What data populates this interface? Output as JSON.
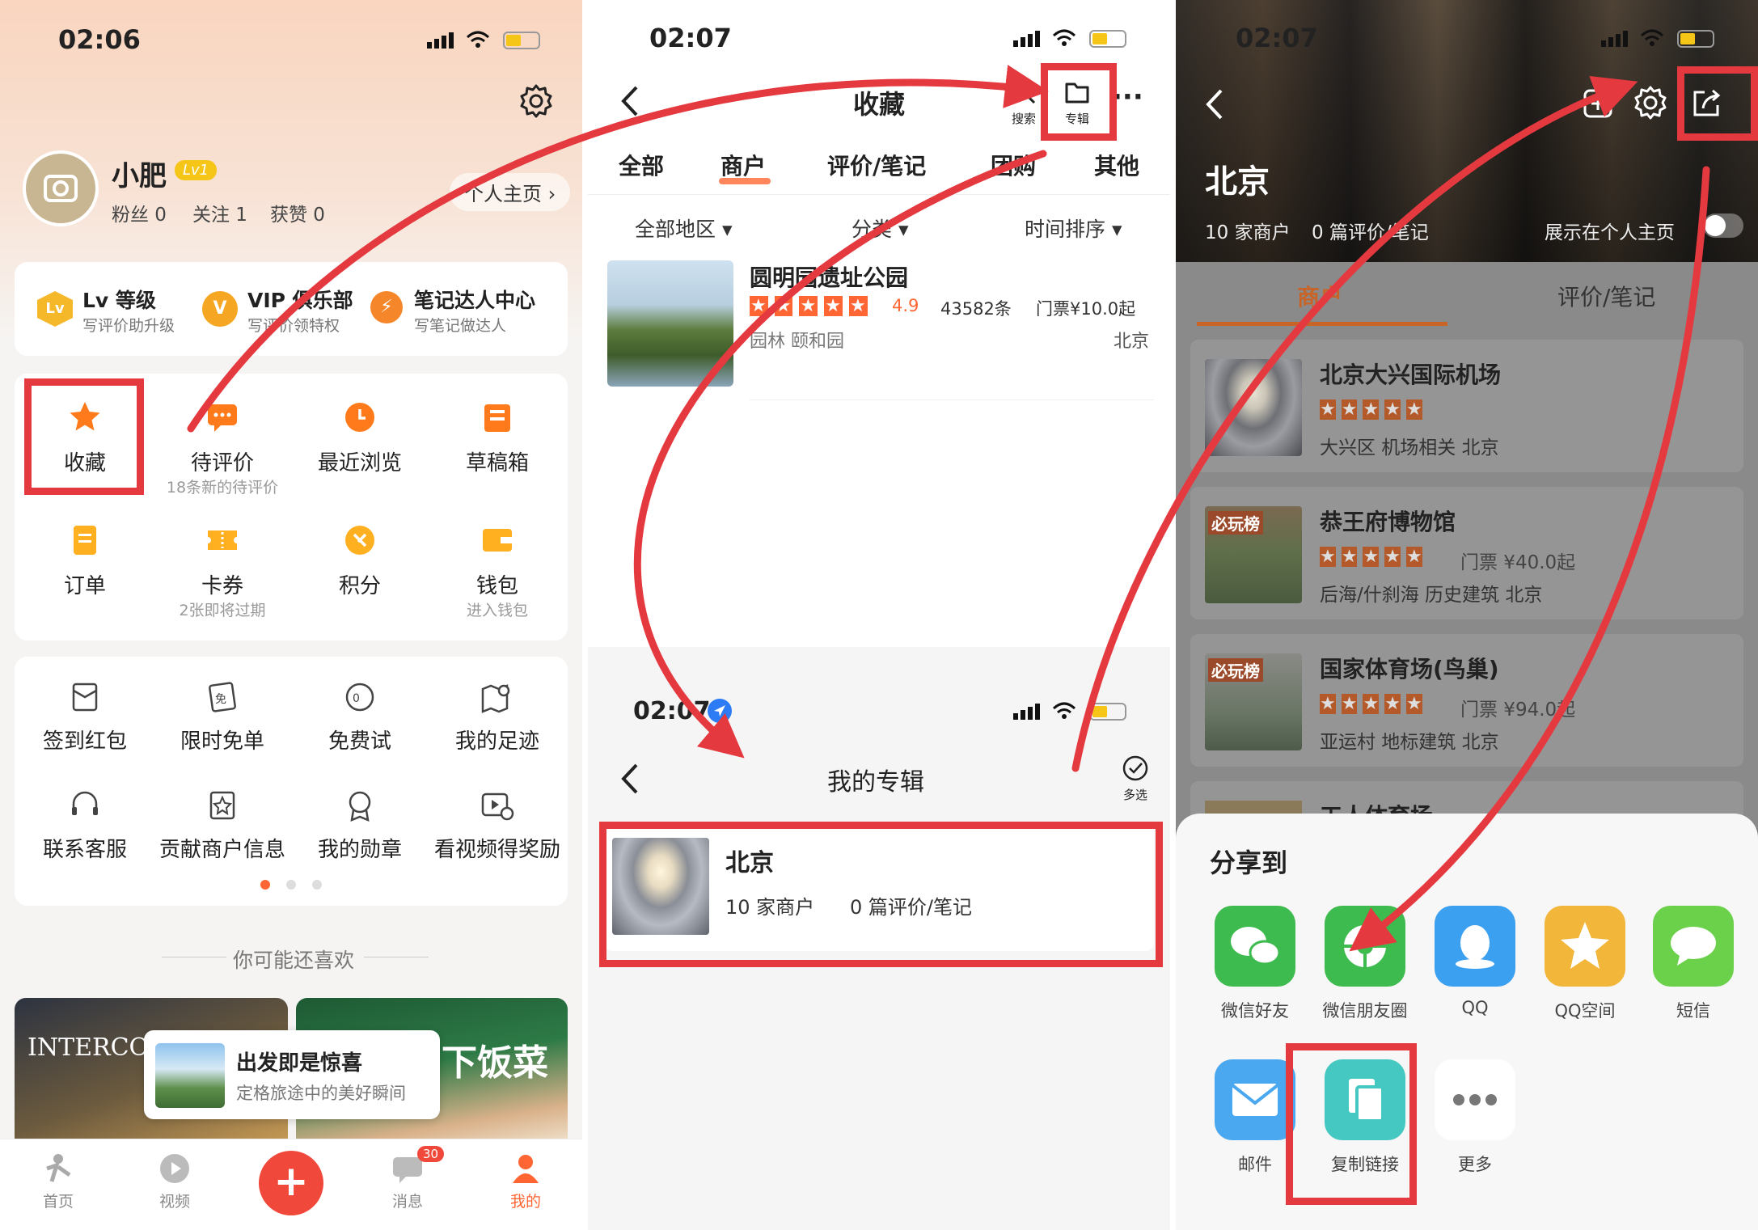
{
  "p1": {
    "time": "02:06",
    "username": "小肥",
    "level_badge": "Lv1",
    "stats": [
      "粉丝 0",
      "关注 1",
      "获赞 0"
    ],
    "homepage_btn": "个人主页 ›",
    "perks": [
      {
        "title": "Lv 等级",
        "sub": "写评价助升级",
        "icon": "Lv"
      },
      {
        "title": "VIP 俱乐部",
        "sub": "写评价领特权",
        "icon": "V"
      },
      {
        "title": "笔记达人中心",
        "sub": "写笔记做达人",
        "icon": "⚡"
      }
    ],
    "grid1": [
      {
        "label": "收藏",
        "sub": ""
      },
      {
        "label": "待评价",
        "sub": "18条新的待评价"
      },
      {
        "label": "最近浏览",
        "sub": ""
      },
      {
        "label": "草稿箱",
        "sub": ""
      },
      {
        "label": "订单",
        "sub": ""
      },
      {
        "label": "卡券",
        "sub": "2张即将过期"
      },
      {
        "label": "积分",
        "sub": ""
      },
      {
        "label": "钱包",
        "sub": "进入钱包"
      }
    ],
    "grid2": [
      {
        "label": "签到红包"
      },
      {
        "label": "限时免单"
      },
      {
        "label": "免费试"
      },
      {
        "label": "我的足迹"
      },
      {
        "label": "联系客服"
      },
      {
        "label": "贡献商户信息"
      },
      {
        "label": "我的勋章"
      },
      {
        "label": "看视频得奖励"
      }
    ],
    "recommend_title": "你可能还喜欢",
    "banner_title": "出发即是惊喜",
    "banner_sub": "定格旅途中的美好瞬间",
    "banner_text_right": "下饭菜",
    "hotel_text": "INTERCO",
    "tabbar": [
      {
        "label": "首页"
      },
      {
        "label": "视频"
      },
      {
        "label": "+"
      },
      {
        "label": "消息",
        "badge": "30"
      },
      {
        "label": "我的"
      }
    ]
  },
  "p2": {
    "time": "02:07",
    "title": "收藏",
    "search_label": "搜索",
    "album_label": "专辑",
    "more": "···",
    "tabs": [
      "全部",
      "商户",
      "评价/笔记",
      "团购",
      "其他"
    ],
    "filters": [
      "全部地区 ▾",
      "分类 ▾",
      "时间排序 ▾"
    ],
    "item": {
      "name": "圆明园遗址公园",
      "rating": "4.9",
      "reviews": "43582条",
      "price": "门票¥10.0起",
      "tags": "园林 颐和园",
      "city": "北京"
    },
    "time2": "02:07",
    "title2": "我的专辑",
    "multi_select": "多选",
    "album": {
      "name": "北京",
      "count": "10 家商户",
      "notes": "0 篇评价/笔记"
    }
  },
  "p3": {
    "time": "02:07",
    "city": "北京",
    "count": "10 家商户",
    "notes": "0 篇评价/笔记",
    "show_homepage": "展示在个人主页",
    "tabs": [
      "商户",
      "评价/笔记"
    ],
    "items": [
      {
        "name": "北京大兴国际机场",
        "line2": "",
        "tags": "大兴区 机场相关  北京"
      },
      {
        "name": "恭王府博物馆",
        "line2": "门票 ¥40.0起",
        "tags": "后海/什刹海 历史建筑  北京",
        "badge": "必玩榜"
      },
      {
        "name": "国家体育场(鸟巢)",
        "line2": "门票 ¥94.0起",
        "tags": "亚运村 地标建筑  北京",
        "badge": "必玩榜"
      },
      {
        "name": "工人体育场",
        "line2": "",
        "tags": ""
      }
    ],
    "share_title": "分享到",
    "share": [
      {
        "label": "微信好友",
        "color": "#3dbb4e"
      },
      {
        "label": "微信朋友圈",
        "color": "#3dbb4e"
      },
      {
        "label": "QQ",
        "color": "#3ba0f0"
      },
      {
        "label": "QQ空间",
        "color": "#f2b63a"
      },
      {
        "label": "短信",
        "color": "#6bd14a"
      },
      {
        "label": "邮件",
        "color": "#4aa8f0"
      },
      {
        "label": "复制链接",
        "color": "#45c7c2"
      },
      {
        "label": "更多",
        "color": "#ffffff"
      }
    ]
  },
  "colors": {
    "accent": "#ff6633",
    "annotation_red": "#e53940"
  }
}
